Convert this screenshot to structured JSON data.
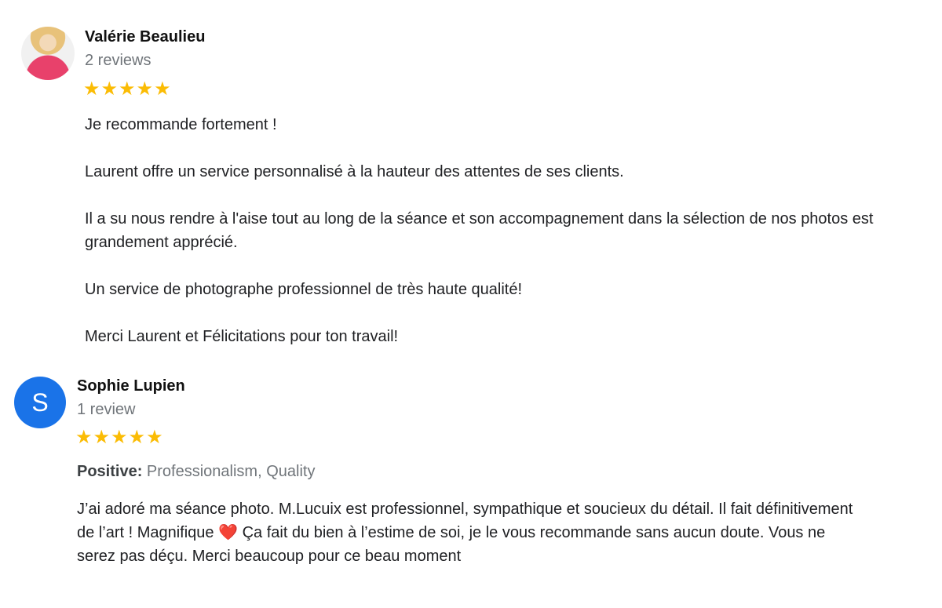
{
  "reviews": [
    {
      "name": "Valérie Beaulieu",
      "count": "2 reviews",
      "rating": 5,
      "stars": "★★★★★",
      "paragraphs": [
        "Je recommande fortement !",
        "Laurent offre un service personnalisé à la hauteur des attentes de ses clients.",
        "Il a su nous rendre à l'aise tout au long de la séance et son accompagnement dans la sélection de nos photos est grandement apprécié.",
        "Un service de photographe professionnel de très haute qualité!",
        "Merci Laurent et Félicitations pour ton travail!"
      ]
    },
    {
      "name": "Sophie Lupien",
      "count": "1 review",
      "avatar_letter": "S",
      "avatar_color": "#1a73e8",
      "rating": 5,
      "stars": "★★★★★",
      "positive_label": "Positive:",
      "positive_values": "Professionalism, Quality",
      "text_before_heart": "J’ai adoré ma séance photo. M.Lucuix est professionnel, sympathique et soucieux du détail. Il fait définitivement de l’art ! Magnifique ",
      "heart": "❤️",
      "text_after_heart": " Ça fait du bien à l’estime de soi, je le vous recommande sans aucun doute. Vous ne serez pas déçu. Merci beaucoup pour ce beau moment"
    }
  ]
}
